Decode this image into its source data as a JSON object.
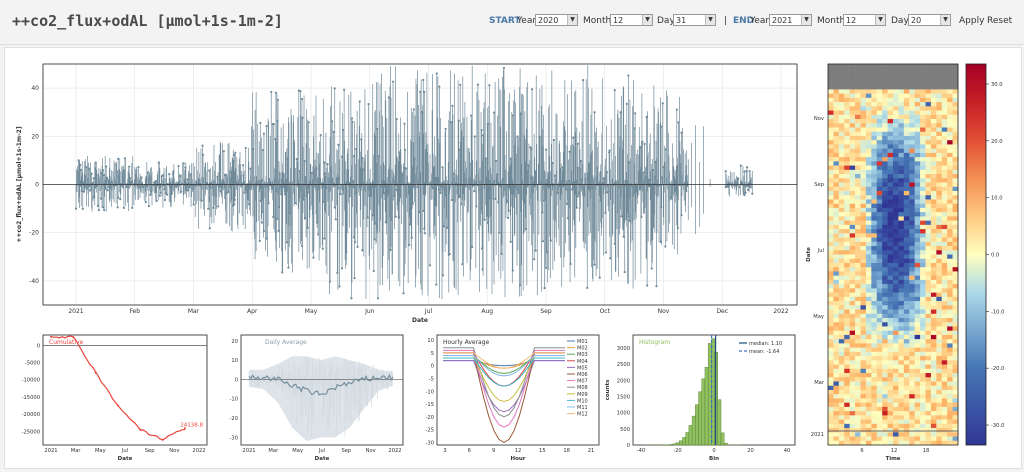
{
  "header": {
    "title": "++co2_flux+odAL [µmol+1s-1m-2]"
  },
  "controls": {
    "start_label": "START",
    "end_label": "END",
    "separator": "|",
    "year_label": "Year",
    "month_label": "Month",
    "day_label": "Day",
    "start_year": "2020",
    "start_month": "12",
    "start_day": "31",
    "end_year": "2021",
    "end_month": "12",
    "end_day": "20",
    "apply": "Apply",
    "reset": "Reset"
  },
  "colors": {
    "series": "#708a99",
    "cumulative": "#e8443a",
    "histogram": "#90c060",
    "median": "#1f4e8a",
    "mean": "#3a76c0",
    "accent": "#4a78a8"
  },
  "chart_data": [
    {
      "id": "timeseries",
      "type": "line",
      "xlabel": "Date",
      "ylabel": "++co2_flux+odAL [µmol+1s-1m-2]",
      "ylim": [
        -50,
        50
      ],
      "yticks": [
        -40,
        -20,
        0,
        20,
        40
      ],
      "xticks": [
        "2021",
        "Feb",
        "Mar",
        "Apr",
        "May",
        "Jun",
        "Jul",
        "Aug",
        "Sep",
        "Oct",
        "Nov",
        "Dec",
        "2022"
      ],
      "envelope": {
        "months": [
          "Jan",
          "Feb",
          "Mar",
          "Apr",
          "May",
          "Jun",
          "Jul",
          "Aug",
          "Sep",
          "Oct",
          "Nov",
          "Dec"
        ],
        "max": [
          12,
          10,
          18,
          40,
          42,
          50,
          50,
          50,
          50,
          48,
          40,
          8
        ],
        "min": [
          -12,
          -10,
          -20,
          -40,
          -48,
          -48,
          -48,
          -48,
          -46,
          -44,
          -30,
          -5
        ]
      },
      "grid": true
    },
    {
      "id": "cumulative",
      "type": "line",
      "label": "Cumulative",
      "xlabel": "Date",
      "yticks": [
        0,
        -5000,
        -10000,
        -15000,
        -20000,
        -25000
      ],
      "xticks": [
        "2021",
        "Mar",
        "May",
        "Jul",
        "Sep",
        "Nov",
        "2022"
      ],
      "x": [
        "2021",
        "Mar",
        "May",
        "Jul",
        "Sep",
        "Nov",
        "Dec"
      ],
      "values": [
        2500,
        2400,
        -8000,
        -17500,
        -24500,
        -27500,
        -24138.8
      ],
      "annotation": "24138.8"
    },
    {
      "id": "daily",
      "type": "line",
      "label": "Daily Average",
      "xlabel": "Date",
      "yticks": [
        20,
        10,
        0,
        -10,
        -20,
        -30
      ],
      "xticks": [
        "2021",
        "Mar",
        "May",
        "Jul",
        "Sep",
        "Nov",
        "2022"
      ],
      "x": [
        "2021",
        "Mar",
        "Apr",
        "May",
        "Jun",
        "Jul",
        "Aug",
        "Sep",
        "Oct",
        "Nov",
        "Dec"
      ],
      "values": [
        1,
        1,
        0,
        -3,
        -6,
        -8,
        -4,
        -2,
        0,
        1,
        1
      ],
      "band_max": [
        5,
        5,
        8,
        12,
        12,
        10,
        12,
        10,
        8,
        5,
        4
      ],
      "band_min": [
        -4,
        -5,
        -12,
        -25,
        -32,
        -30,
        -30,
        -25,
        -15,
        -6,
        -3
      ]
    },
    {
      "id": "hourly",
      "type": "line",
      "label": "Hourly Average",
      "xlabel": "Hour",
      "yticks": [
        10,
        5,
        0,
        -5,
        -10,
        -15,
        -20,
        -25,
        -30
      ],
      "xticks": [
        "3",
        "6",
        "9",
        "12",
        "15",
        "18",
        "21"
      ],
      "series": [
        {
          "name": "M01",
          "min": 0
        },
        {
          "name": "M02",
          "min": -1
        },
        {
          "name": "M03",
          "min": -3
        },
        {
          "name": "M04",
          "min": -8
        },
        {
          "name": "M05",
          "min": -18
        },
        {
          "name": "M06",
          "min": -30
        },
        {
          "name": "M07",
          "min": -24
        },
        {
          "name": "M08",
          "min": -20
        },
        {
          "name": "M09",
          "min": -14
        },
        {
          "name": "M10",
          "min": -8
        },
        {
          "name": "M11",
          "min": -4
        },
        {
          "name": "M12",
          "min": -1
        }
      ]
    },
    {
      "id": "histogram",
      "type": "bar",
      "label": "Histogram",
      "xlabel": "Bin",
      "ylabel": "counts",
      "yticks": [
        3000,
        2500,
        2000,
        1500,
        1000,
        500,
        0
      ],
      "xticks": [
        "-40",
        "-20",
        "0",
        "20",
        "40"
      ],
      "median_label": "median: 1.10",
      "mean_label": "mean: -1.64",
      "median": 1.1,
      "mean": -1.64
    },
    {
      "id": "heatmap",
      "type": "heatmap",
      "xlabel": "Time",
      "ylabel": "Date",
      "yticks": [
        "Nov",
        "Sep",
        "Jul",
        "May",
        "Mar",
        "2021"
      ],
      "xticks": [
        "6",
        "12",
        "18"
      ],
      "colorbar_ticks": [
        "30.0",
        "20.0",
        "10.0",
        "0.0",
        "-10.0",
        "-20.0",
        "-30.0"
      ]
    }
  ]
}
